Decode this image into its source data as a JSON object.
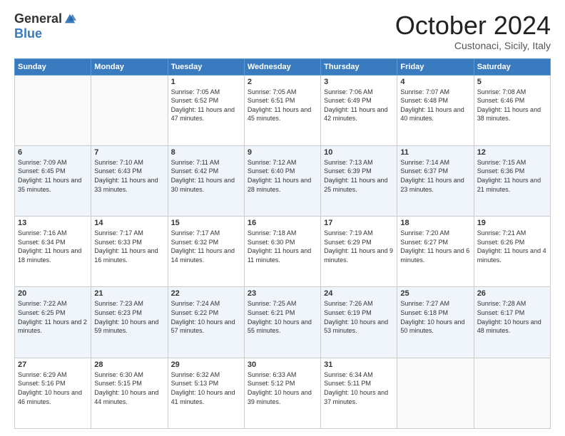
{
  "logo": {
    "general": "General",
    "blue": "Blue"
  },
  "header": {
    "month": "October 2024",
    "location": "Custonaci, Sicily, Italy"
  },
  "weekdays": [
    "Sunday",
    "Monday",
    "Tuesday",
    "Wednesday",
    "Thursday",
    "Friday",
    "Saturday"
  ],
  "weeks": [
    [
      {
        "day": "",
        "info": ""
      },
      {
        "day": "",
        "info": ""
      },
      {
        "day": "1",
        "info": "Sunrise: 7:05 AM\nSunset: 6:52 PM\nDaylight: 11 hours and 47 minutes."
      },
      {
        "day": "2",
        "info": "Sunrise: 7:05 AM\nSunset: 6:51 PM\nDaylight: 11 hours and 45 minutes."
      },
      {
        "day": "3",
        "info": "Sunrise: 7:06 AM\nSunset: 6:49 PM\nDaylight: 11 hours and 42 minutes."
      },
      {
        "day": "4",
        "info": "Sunrise: 7:07 AM\nSunset: 6:48 PM\nDaylight: 11 hours and 40 minutes."
      },
      {
        "day": "5",
        "info": "Sunrise: 7:08 AM\nSunset: 6:46 PM\nDaylight: 11 hours and 38 minutes."
      }
    ],
    [
      {
        "day": "6",
        "info": "Sunrise: 7:09 AM\nSunset: 6:45 PM\nDaylight: 11 hours and 35 minutes."
      },
      {
        "day": "7",
        "info": "Sunrise: 7:10 AM\nSunset: 6:43 PM\nDaylight: 11 hours and 33 minutes."
      },
      {
        "day": "8",
        "info": "Sunrise: 7:11 AM\nSunset: 6:42 PM\nDaylight: 11 hours and 30 minutes."
      },
      {
        "day": "9",
        "info": "Sunrise: 7:12 AM\nSunset: 6:40 PM\nDaylight: 11 hours and 28 minutes."
      },
      {
        "day": "10",
        "info": "Sunrise: 7:13 AM\nSunset: 6:39 PM\nDaylight: 11 hours and 25 minutes."
      },
      {
        "day": "11",
        "info": "Sunrise: 7:14 AM\nSunset: 6:37 PM\nDaylight: 11 hours and 23 minutes."
      },
      {
        "day": "12",
        "info": "Sunrise: 7:15 AM\nSunset: 6:36 PM\nDaylight: 11 hours and 21 minutes."
      }
    ],
    [
      {
        "day": "13",
        "info": "Sunrise: 7:16 AM\nSunset: 6:34 PM\nDaylight: 11 hours and 18 minutes."
      },
      {
        "day": "14",
        "info": "Sunrise: 7:17 AM\nSunset: 6:33 PM\nDaylight: 11 hours and 16 minutes."
      },
      {
        "day": "15",
        "info": "Sunrise: 7:17 AM\nSunset: 6:32 PM\nDaylight: 11 hours and 14 minutes."
      },
      {
        "day": "16",
        "info": "Sunrise: 7:18 AM\nSunset: 6:30 PM\nDaylight: 11 hours and 11 minutes."
      },
      {
        "day": "17",
        "info": "Sunrise: 7:19 AM\nSunset: 6:29 PM\nDaylight: 11 hours and 9 minutes."
      },
      {
        "day": "18",
        "info": "Sunrise: 7:20 AM\nSunset: 6:27 PM\nDaylight: 11 hours and 6 minutes."
      },
      {
        "day": "19",
        "info": "Sunrise: 7:21 AM\nSunset: 6:26 PM\nDaylight: 11 hours and 4 minutes."
      }
    ],
    [
      {
        "day": "20",
        "info": "Sunrise: 7:22 AM\nSunset: 6:25 PM\nDaylight: 11 hours and 2 minutes."
      },
      {
        "day": "21",
        "info": "Sunrise: 7:23 AM\nSunset: 6:23 PM\nDaylight: 10 hours and 59 minutes."
      },
      {
        "day": "22",
        "info": "Sunrise: 7:24 AM\nSunset: 6:22 PM\nDaylight: 10 hours and 57 minutes."
      },
      {
        "day": "23",
        "info": "Sunrise: 7:25 AM\nSunset: 6:21 PM\nDaylight: 10 hours and 55 minutes."
      },
      {
        "day": "24",
        "info": "Sunrise: 7:26 AM\nSunset: 6:19 PM\nDaylight: 10 hours and 53 minutes."
      },
      {
        "day": "25",
        "info": "Sunrise: 7:27 AM\nSunset: 6:18 PM\nDaylight: 10 hours and 50 minutes."
      },
      {
        "day": "26",
        "info": "Sunrise: 7:28 AM\nSunset: 6:17 PM\nDaylight: 10 hours and 48 minutes."
      }
    ],
    [
      {
        "day": "27",
        "info": "Sunrise: 6:29 AM\nSunset: 5:16 PM\nDaylight: 10 hours and 46 minutes."
      },
      {
        "day": "28",
        "info": "Sunrise: 6:30 AM\nSunset: 5:15 PM\nDaylight: 10 hours and 44 minutes."
      },
      {
        "day": "29",
        "info": "Sunrise: 6:32 AM\nSunset: 5:13 PM\nDaylight: 10 hours and 41 minutes."
      },
      {
        "day": "30",
        "info": "Sunrise: 6:33 AM\nSunset: 5:12 PM\nDaylight: 10 hours and 39 minutes."
      },
      {
        "day": "31",
        "info": "Sunrise: 6:34 AM\nSunset: 5:11 PM\nDaylight: 10 hours and 37 minutes."
      },
      {
        "day": "",
        "info": ""
      },
      {
        "day": "",
        "info": ""
      }
    ]
  ]
}
